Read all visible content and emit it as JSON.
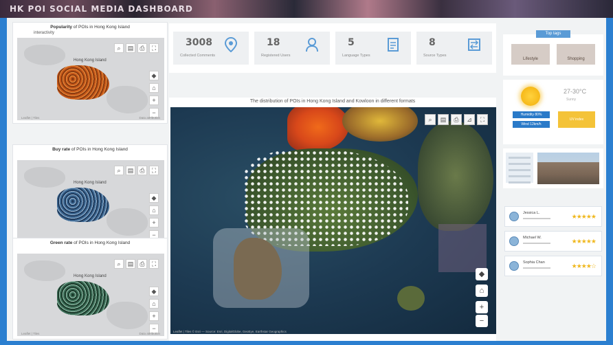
{
  "banner": {
    "title": "HK POI SOCIAL MEDIA DASHBOARD"
  },
  "mini_panels": [
    {
      "title_bold": "Popularity",
      "title_rest": " of POIs in Hong Kong Island",
      "subtitle": "interactivity",
      "island_label": "Hong Kong Island",
      "footer_left": "Leaflet | Tiles",
      "footer_right": "Data attribution",
      "palette": [
        "#8a3a10",
        "#c85a1a",
        "#e89040"
      ]
    },
    {
      "title_bold": "Buy rate",
      "title_rest": " of POIs in Hong Kong Island",
      "subtitle": "",
      "island_label": "Hong Kong Island",
      "footer_left": "Leaflet | Tiles",
      "footer_right": "Data attribution",
      "palette": [
        "#1e3a5c",
        "#3f6a94",
        "#9ab8d4"
      ]
    },
    {
      "title_bold": "Green rate",
      "title_rest": " of POIs in Hong Kong Island",
      "subtitle": "",
      "island_label": "Hong Kong Island",
      "footer_left": "Leaflet | Tiles",
      "footer_right": "Data attribution",
      "palette": [
        "#1a3a2a",
        "#3d6e58",
        "#9ac4b0"
      ]
    }
  ],
  "stats": [
    {
      "value": "3008",
      "label": "Collected Comments",
      "icon": "location-pin-icon"
    },
    {
      "value": "18",
      "label": "Registered Users",
      "icon": "user-icon"
    },
    {
      "value": "5",
      "label": "Language Types",
      "icon": "document-icon"
    },
    {
      "value": "8",
      "label": "Source Types",
      "icon": "transfer-icon"
    }
  ],
  "map": {
    "title": "The distribution of POIs in Hong Kong Island and Kowloon in different formats",
    "footer": "Leaflet | Tiles © Esri — Source: Esri, DigitalGlobe, GeoEye, Earthstar Geographics"
  },
  "right": {
    "tag_header": "Top tags",
    "tags": [
      "Lifestyle",
      "Shopping"
    ],
    "temperature": "27-30°C",
    "temp_sub": "Sunny",
    "wx_labels": [
      "Humidity 80%",
      "Wind 12km/h",
      "UV index"
    ],
    "reviews": [
      {
        "name": "Jessica L.",
        "stars": "★★★★★"
      },
      {
        "name": "Michael W.",
        "stars": "★★★★★"
      },
      {
        "name": "Sophia Chan",
        "stars": "★★★★☆"
      }
    ]
  },
  "colors": {
    "accent": "#2b7fd0",
    "star": "#f0b81f",
    "sun": "#f6b919"
  }
}
